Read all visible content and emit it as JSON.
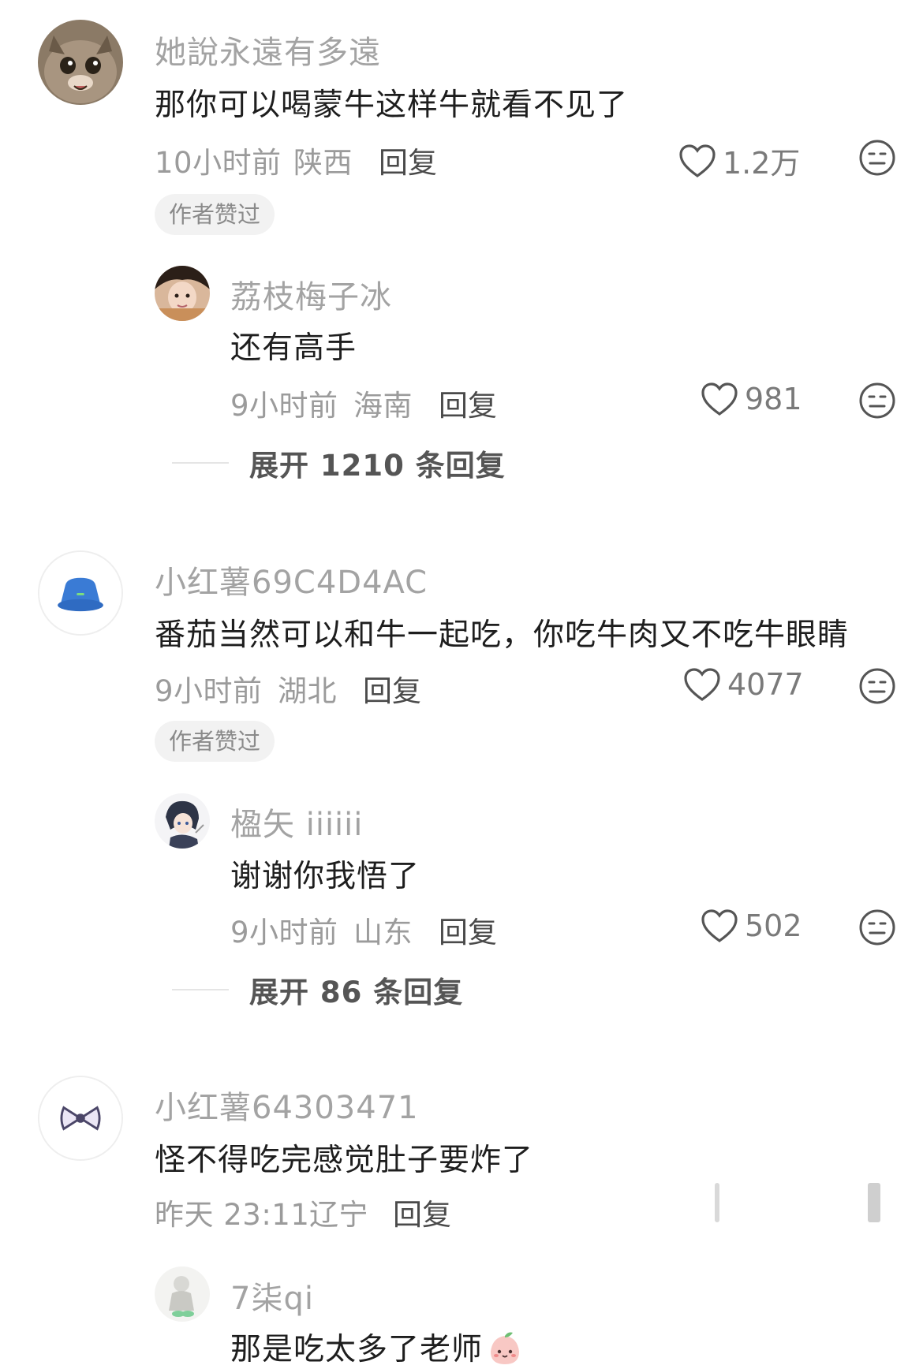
{
  "comments": [
    {
      "username": "她說永遠有多遠",
      "text": "那你可以喝蒙牛这样牛就看不见了",
      "time": "10小时前",
      "location": "陕西",
      "reply_label": "回复",
      "likes": "1.2万",
      "badge": "作者赞过",
      "avatar_icon": "cat-avatar-icon",
      "sub_reply": {
        "username": "荔枝梅子冰",
        "text": "还有高手",
        "time": "9小时前",
        "location": "海南",
        "reply_label": "回复",
        "likes": "981",
        "avatar_icon": "girl-avatar-icon"
      },
      "expand_label": "展开 1210 条回复"
    },
    {
      "username": "小红薯69C4D4AC",
      "text": "番茄当然可以和牛一起吃，你吃牛肉又不吃牛眼睛",
      "time": "9小时前",
      "location": "湖北",
      "reply_label": "回复",
      "likes": "4077",
      "badge": "作者赞过",
      "avatar_icon": "blue-hat-avatar-icon",
      "sub_reply": {
        "username": "楹矢 iiiiii",
        "text": "谢谢你我悟了",
        "time": "9小时前",
        "location": "山东",
        "reply_label": "回复",
        "likes": "502",
        "avatar_icon": "anime-avatar-icon"
      },
      "expand_label": "展开 86 条回复"
    },
    {
      "username": "小红薯64303471",
      "text": "怪不得吃完感觉肚子要炸了",
      "time": "昨天 23:11",
      "location": "辽宁",
      "reply_label": "回复",
      "avatar_icon": "bow-avatar-icon",
      "sub_reply": {
        "username": "7柒qi",
        "text": "那是吃太多了老师",
        "avatar_icon": "sketch-avatar-icon",
        "emoji_icon": "peach-face-emoji-icon"
      }
    }
  ],
  "colors": {
    "username": "#a3a3a3",
    "content": "#1e1e1e",
    "meta": "#9b9b9b",
    "badge_bg": "#f2f2f2"
  }
}
